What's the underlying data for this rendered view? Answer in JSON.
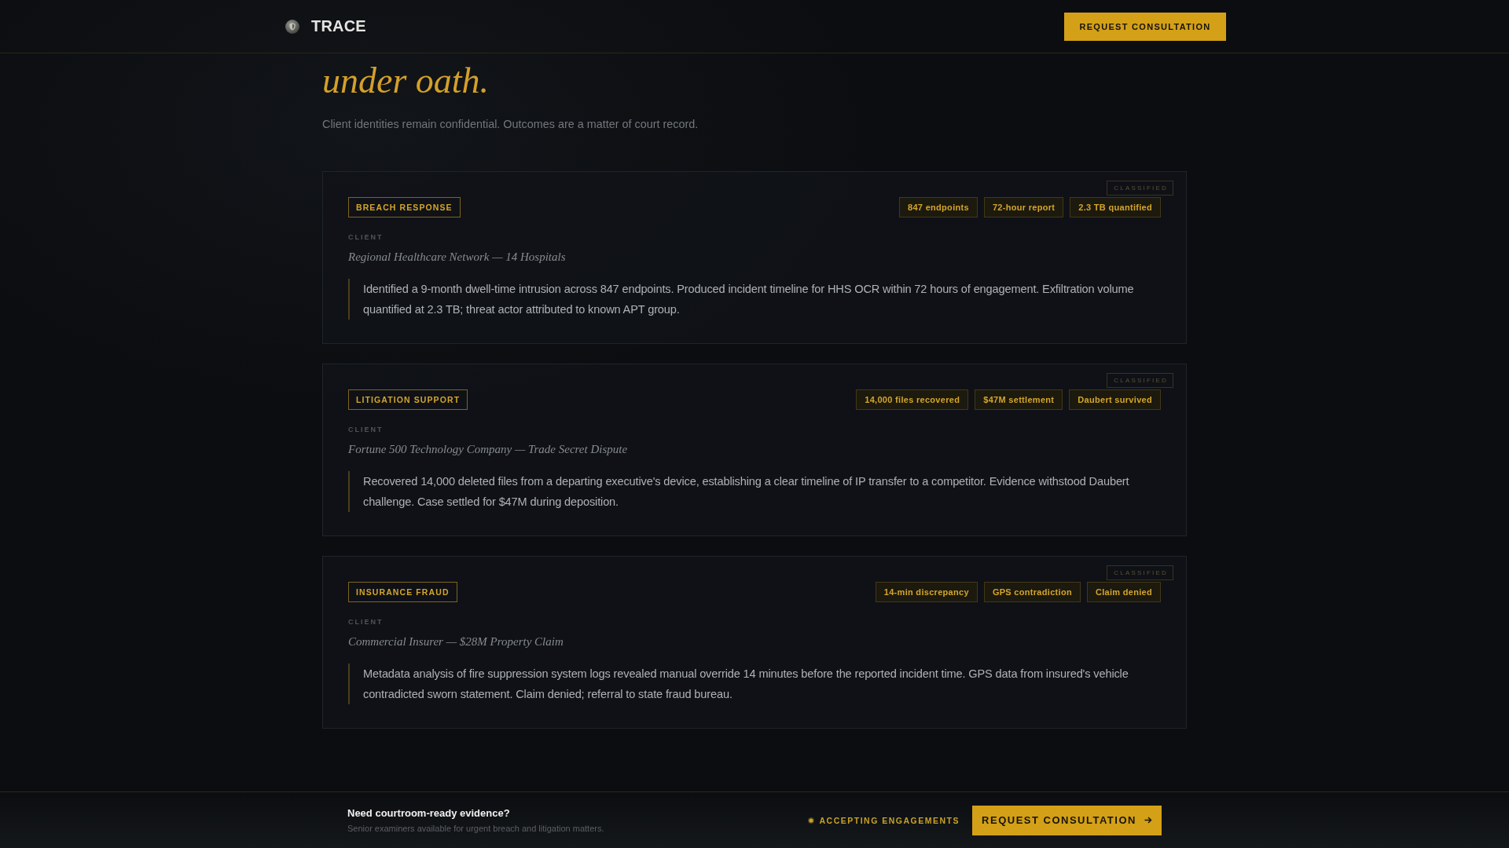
{
  "header": {
    "brand": "TRACE",
    "cta": "REQUEST CONSULTATION"
  },
  "intro": {
    "heading": "under oath.",
    "subtitle": "Client identities remain confidential. Outcomes are a matter of court record."
  },
  "cases": [
    {
      "category": "BREACH RESPONSE",
      "stamp": "CLASSIFIED",
      "metrics": [
        "847 endpoints",
        "72-hour report",
        "2.3 TB quantified"
      ],
      "client_label": "CLIENT",
      "client": "Regional Healthcare Network — 14 Hospitals",
      "summary": "Identified a 9-month dwell-time intrusion across 847 endpoints. Produced incident timeline for HHS OCR within 72 hours of engagement. Exfiltration volume quantified at 2.3 TB; threat actor attributed to known APT group."
    },
    {
      "category": "LITIGATION SUPPORT",
      "stamp": "CLASSIFIED",
      "metrics": [
        "14,000 files recovered",
        "$47M settlement",
        "Daubert survived"
      ],
      "client_label": "CLIENT",
      "client": "Fortune 500 Technology Company — Trade Secret Dispute",
      "summary": "Recovered 14,000 deleted files from a departing executive's device, establishing a clear timeline of IP transfer to a competitor. Evidence withstood Daubert challenge. Case settled for $47M during deposition."
    },
    {
      "category": "INSURANCE FRAUD",
      "stamp": "CLASSIFIED",
      "metrics": [
        "14-min discrepancy",
        "GPS contradiction",
        "Claim denied"
      ],
      "client_label": "CLIENT",
      "client": "Commercial Insurer — $28M Property Claim",
      "summary": "Metadata analysis of fire suppression system logs revealed manual override 14 minutes before the reported incident time. GPS data from insured's vehicle contradicted sworn statement. Claim denied; referral to state fraud bureau."
    }
  ],
  "footer": {
    "title": "Need courtroom-ready evidence?",
    "subtitle": "Senior examiners available for urgent breach and litigation matters.",
    "status": "ACCEPTING ENGAGEMENTS",
    "cta": "REQUEST CONSULTATION"
  }
}
